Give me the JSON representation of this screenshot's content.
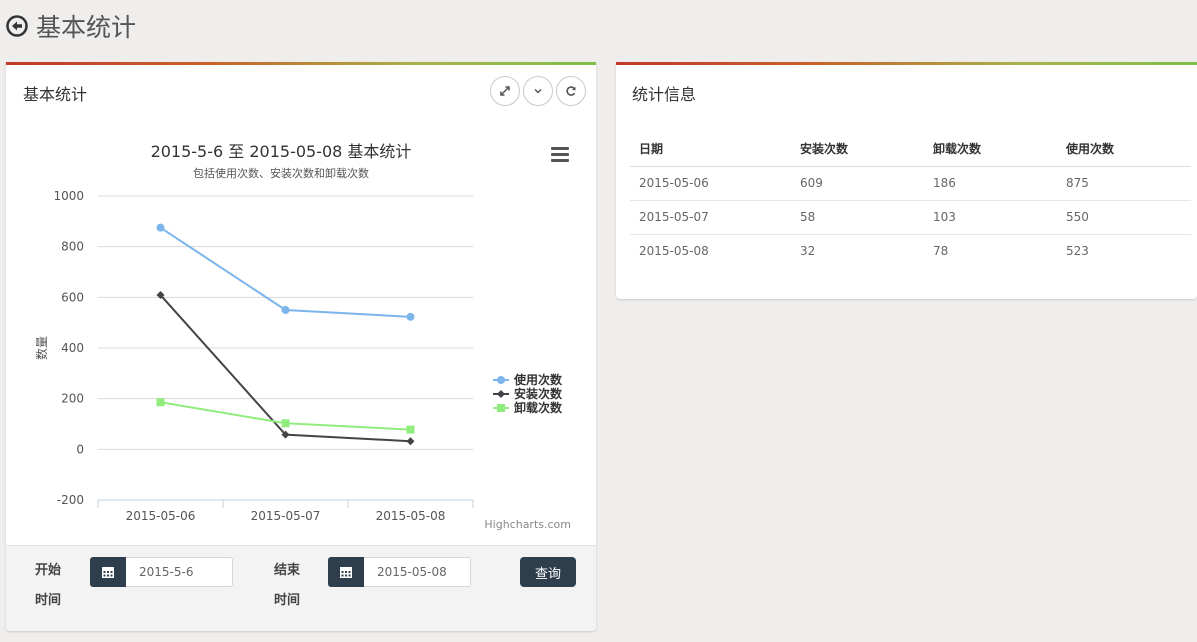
{
  "page": {
    "title": "基本统计"
  },
  "left_panel": {
    "title": "基本统计",
    "tools": [
      "expand-icon",
      "chevron-down-icon",
      "refresh-icon"
    ]
  },
  "chart_data": {
    "type": "line",
    "title": "2015-5-6 至 2015-05-08 基本统计",
    "subtitle": "包括使用次数、安装次数和卸载次数",
    "categories": [
      "2015-05-06",
      "2015-05-07",
      "2015-05-08"
    ],
    "ylabel": "数量",
    "ylim": [
      -200,
      1000
    ],
    "yticks": [
      "1000",
      "800",
      "600",
      "400",
      "200",
      "0",
      "-200"
    ],
    "grid": true,
    "legend_position": "right",
    "credit": "Highcharts.com",
    "series": [
      {
        "name": "使用次数",
        "values": [
          875,
          550,
          523
        ],
        "color": "#7cb5ec",
        "marker": "circle"
      },
      {
        "name": "安装次数",
        "values": [
          609,
          58,
          32
        ],
        "color": "#434348",
        "marker": "diamond"
      },
      {
        "name": "卸载次数",
        "values": [
          186,
          103,
          78
        ],
        "color": "#90ed7d",
        "marker": "square"
      }
    ]
  },
  "form": {
    "start_label": "开始时间",
    "start_value": "2015-5-6",
    "end_label": "结束时间",
    "end_value": "2015-05-08",
    "query_label": "查询"
  },
  "right_panel": {
    "title": "统计信息",
    "columns": [
      "日期",
      "安装次数",
      "卸载次数",
      "使用次数"
    ],
    "rows": [
      [
        "2015-05-06",
        "609",
        "186",
        "875"
      ],
      [
        "2015-05-07",
        "58",
        "103",
        "550"
      ],
      [
        "2015-05-08",
        "32",
        "78",
        "523"
      ]
    ]
  },
  "colors": {
    "accent": "#2e3e4c",
    "header_gradient": [
      "#c0392b",
      "#7fbf4a"
    ]
  }
}
